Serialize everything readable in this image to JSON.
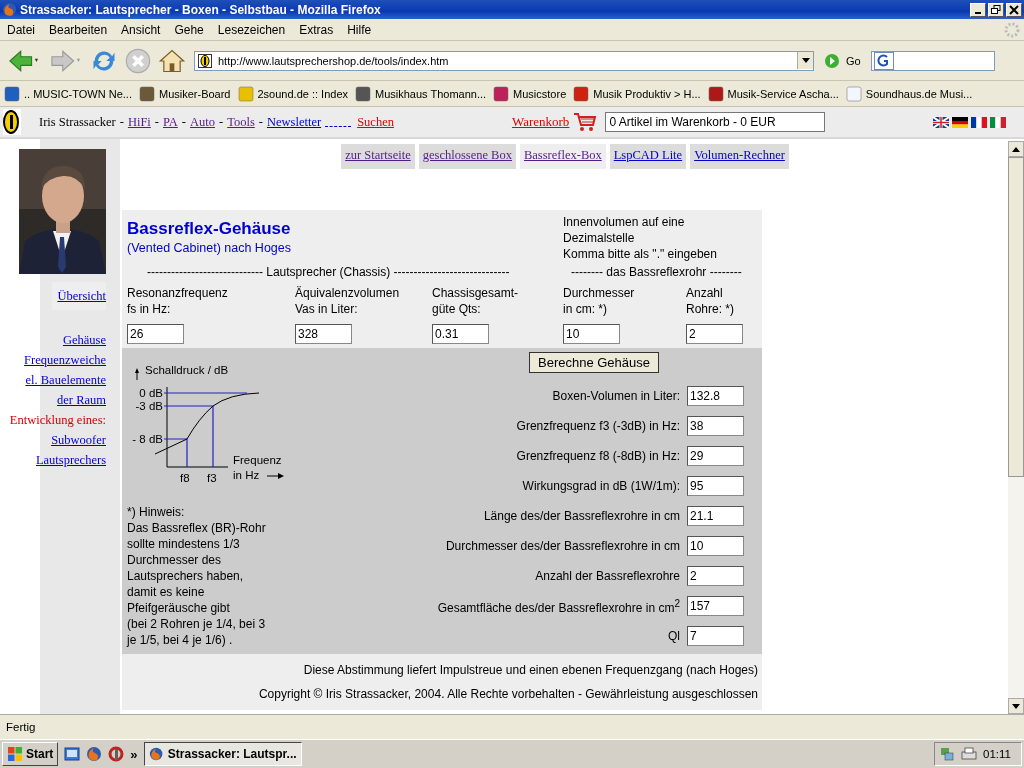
{
  "window": {
    "title": "Strassacker: Lautsprecher - Boxen - Selbstbau - Mozilla Firefox"
  },
  "menu": [
    "Datei",
    "Bearbeiten",
    "Ansicht",
    "Gehe",
    "Lesezeichen",
    "Extras",
    "Hilfe"
  ],
  "navigation": {
    "address": "http://www.lautsprechershop.de/tools/index.htm",
    "go": "Go"
  },
  "bookmarks": [
    {
      "label": ".. MUSIC-TOWN Ne...",
      "color": "#1f5fc0"
    },
    {
      "label": "Musiker-Board",
      "color": "#6b5a3a"
    },
    {
      "label": "2sound.de :: Index",
      "color": "#e8c000"
    },
    {
      "label": "Musikhaus Thomann...",
      "color": "#555555"
    },
    {
      "label": "Musicstore",
      "color": "#c0205a"
    },
    {
      "label": "Musik Produktiv > H...",
      "color": "#d02010"
    },
    {
      "label": "Musik-Service Ascha...",
      "color": "#b01818"
    },
    {
      "label": "Soundhaus.de Musi...",
      "color": "#f4f6ff"
    }
  ],
  "site_header": {
    "brand": "Iris Strassacker",
    "links": [
      {
        "label": "HiFi",
        "separator": "-",
        "kind": "visited"
      },
      {
        "label": "PA",
        "separator": "-",
        "kind": "visited"
      },
      {
        "label": "Auto",
        "separator": "-",
        "kind": "visited"
      },
      {
        "label": "Tools",
        "separator": "-",
        "kind": "visited"
      },
      {
        "label": "Newsletter",
        "separator": "-",
        "kind": "link"
      },
      {
        "label": "Suchen",
        "kind": "search"
      }
    ],
    "cart": {
      "label": "Warenkorb",
      "value": "0 Artikel im Warenkorb - 0 EUR"
    }
  },
  "sidebar": {
    "top_links": [
      "Übersicht"
    ],
    "links": [
      {
        "label": "Gehäuse",
        "kind": "link"
      },
      {
        "label": "Frequenzweiche",
        "kind": "link"
      },
      {
        "label": "el. Bauelemente",
        "kind": "link"
      },
      {
        "label": "der Raum",
        "kind": "link"
      },
      {
        "label": "Entwicklung eines:",
        "kind": "label"
      },
      {
        "label": "Subwoofer",
        "kind": "link"
      },
      {
        "label": "Lautsprechers",
        "kind": "link"
      }
    ]
  },
  "tabs": [
    {
      "label": "zur Startseite",
      "selected": false,
      "visited": true
    },
    {
      "label": "geschlossene Box",
      "selected": false,
      "visited": true
    },
    {
      "label": "Bassreflex-Box",
      "selected": true,
      "visited": true
    },
    {
      "label": "LspCAD Lite",
      "selected": false,
      "visited": false
    },
    {
      "label": "Volumen-Rechner",
      "selected": false,
      "visited": false
    }
  ],
  "form": {
    "title": "Bassreflex-Gehäuse",
    "subtitle": "(Vented Cabinet) nach Hoges",
    "note": [
      "Innenvolumen auf eine",
      "Dezimalstelle",
      "Komma bitte als \".\" eingeben"
    ],
    "section_speaker": "----------------------------- Lautsprecher (Chassis) -----------------------------",
    "section_port": "-------- das Bassreflexrohr --------",
    "inputs": [
      {
        "label": [
          "Resonanzfrequenz",
          "fs in Hz:"
        ],
        "value": "26"
      },
      {
        "label": [
          "Äquivalenzvolumen",
          "Vas in Liter:"
        ],
        "value": "328"
      },
      {
        "label": [
          "Chassisgesamt-",
          "güte Qts:"
        ],
        "value": "0.31"
      },
      {
        "label": [
          "Durchmesser",
          "in cm: *)"
        ],
        "value": "10"
      },
      {
        "label": [
          "Anzahl",
          "Rohre: *)"
        ],
        "value": "2"
      }
    ],
    "calculate_button": "Berechne Gehäuse",
    "diagram": {
      "y_label": "Schalldruck / dB",
      "levels": [
        "0 dB",
        "-3 dB",
        "- 8 dB"
      ],
      "ticks": [
        "f8",
        "f3"
      ],
      "x_label": [
        "Frequenz",
        "in Hz"
      ]
    },
    "hint": [
      "*) Hinweis:",
      "Das Bassreflex (BR)-Rohr",
      "sollte mindestens 1/3",
      "Durchmesser des",
      "Lautsprechers haben,",
      "damit es keine",
      "Pfeifgeräusche gibt",
      "(bei 2 Rohren je 1/4, bei 3",
      "je 1/5, bei 4 je 1/6) ."
    ],
    "results": [
      {
        "label": "Boxen-Volumen in Liter:",
        "value": "132.8"
      },
      {
        "label": "Grenzfrequenz f3 (-3dB) in Hz:",
        "value": "38"
      },
      {
        "label": "Grenzfrequenz f8 (-8dB) in Hz:",
        "value": "29"
      },
      {
        "label": "Wirkungsgrad in dB (1W/1m):",
        "value": "95"
      },
      {
        "label": "Länge des/der Bassreflexrohre in cm",
        "value": "21.1"
      },
      {
        "label": "Durchmesser des/der Bassreflexrohre in cm",
        "value": "10"
      },
      {
        "label": "Anzahl der Bassreflexrohre",
        "value": "2"
      },
      {
        "label": "Gesamtfläche des/der Bassreflexrohre in cm$^{2}$",
        "value": "157"
      },
      {
        "label": "Ql",
        "value": "7"
      }
    ],
    "footer": [
      "Diese Abstimmung liefert Impulstreue und einen ebenen Frequenzgang (nach Hoges)",
      "Copyright © Iris Strassacker, 2004. Alle Rechte vorbehalten - Gewährleistung ausgeschlossen"
    ]
  },
  "status_bar": {
    "text": "Fertig"
  },
  "taskbar": {
    "start": "Start",
    "more": "»",
    "task": "Strassacker: Lautspr...",
    "clock": "01:11"
  }
}
